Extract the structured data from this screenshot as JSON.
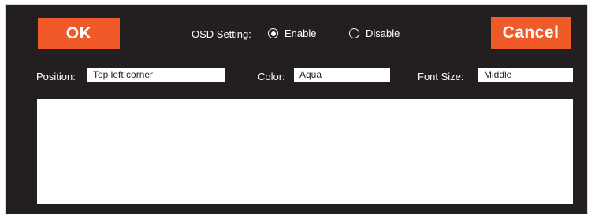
{
  "colors": {
    "panel_background": "#231f20",
    "button_orange": "#f05a28",
    "text": "#ffffff",
    "field_background": "#ffffff"
  },
  "buttons": {
    "ok_label": "OK",
    "cancel_label": "Cancel"
  },
  "osd": {
    "label": "OSD Setting:",
    "options": [
      {
        "label": "Enable",
        "selected": true
      },
      {
        "label": "Disable",
        "selected": false
      }
    ]
  },
  "fields": {
    "position": {
      "label": "Position:",
      "value": "Top left corner"
    },
    "color": {
      "label": "Color:",
      "value": "Aqua"
    },
    "font_size": {
      "label": "Font Size:",
      "value": "Middle"
    }
  }
}
